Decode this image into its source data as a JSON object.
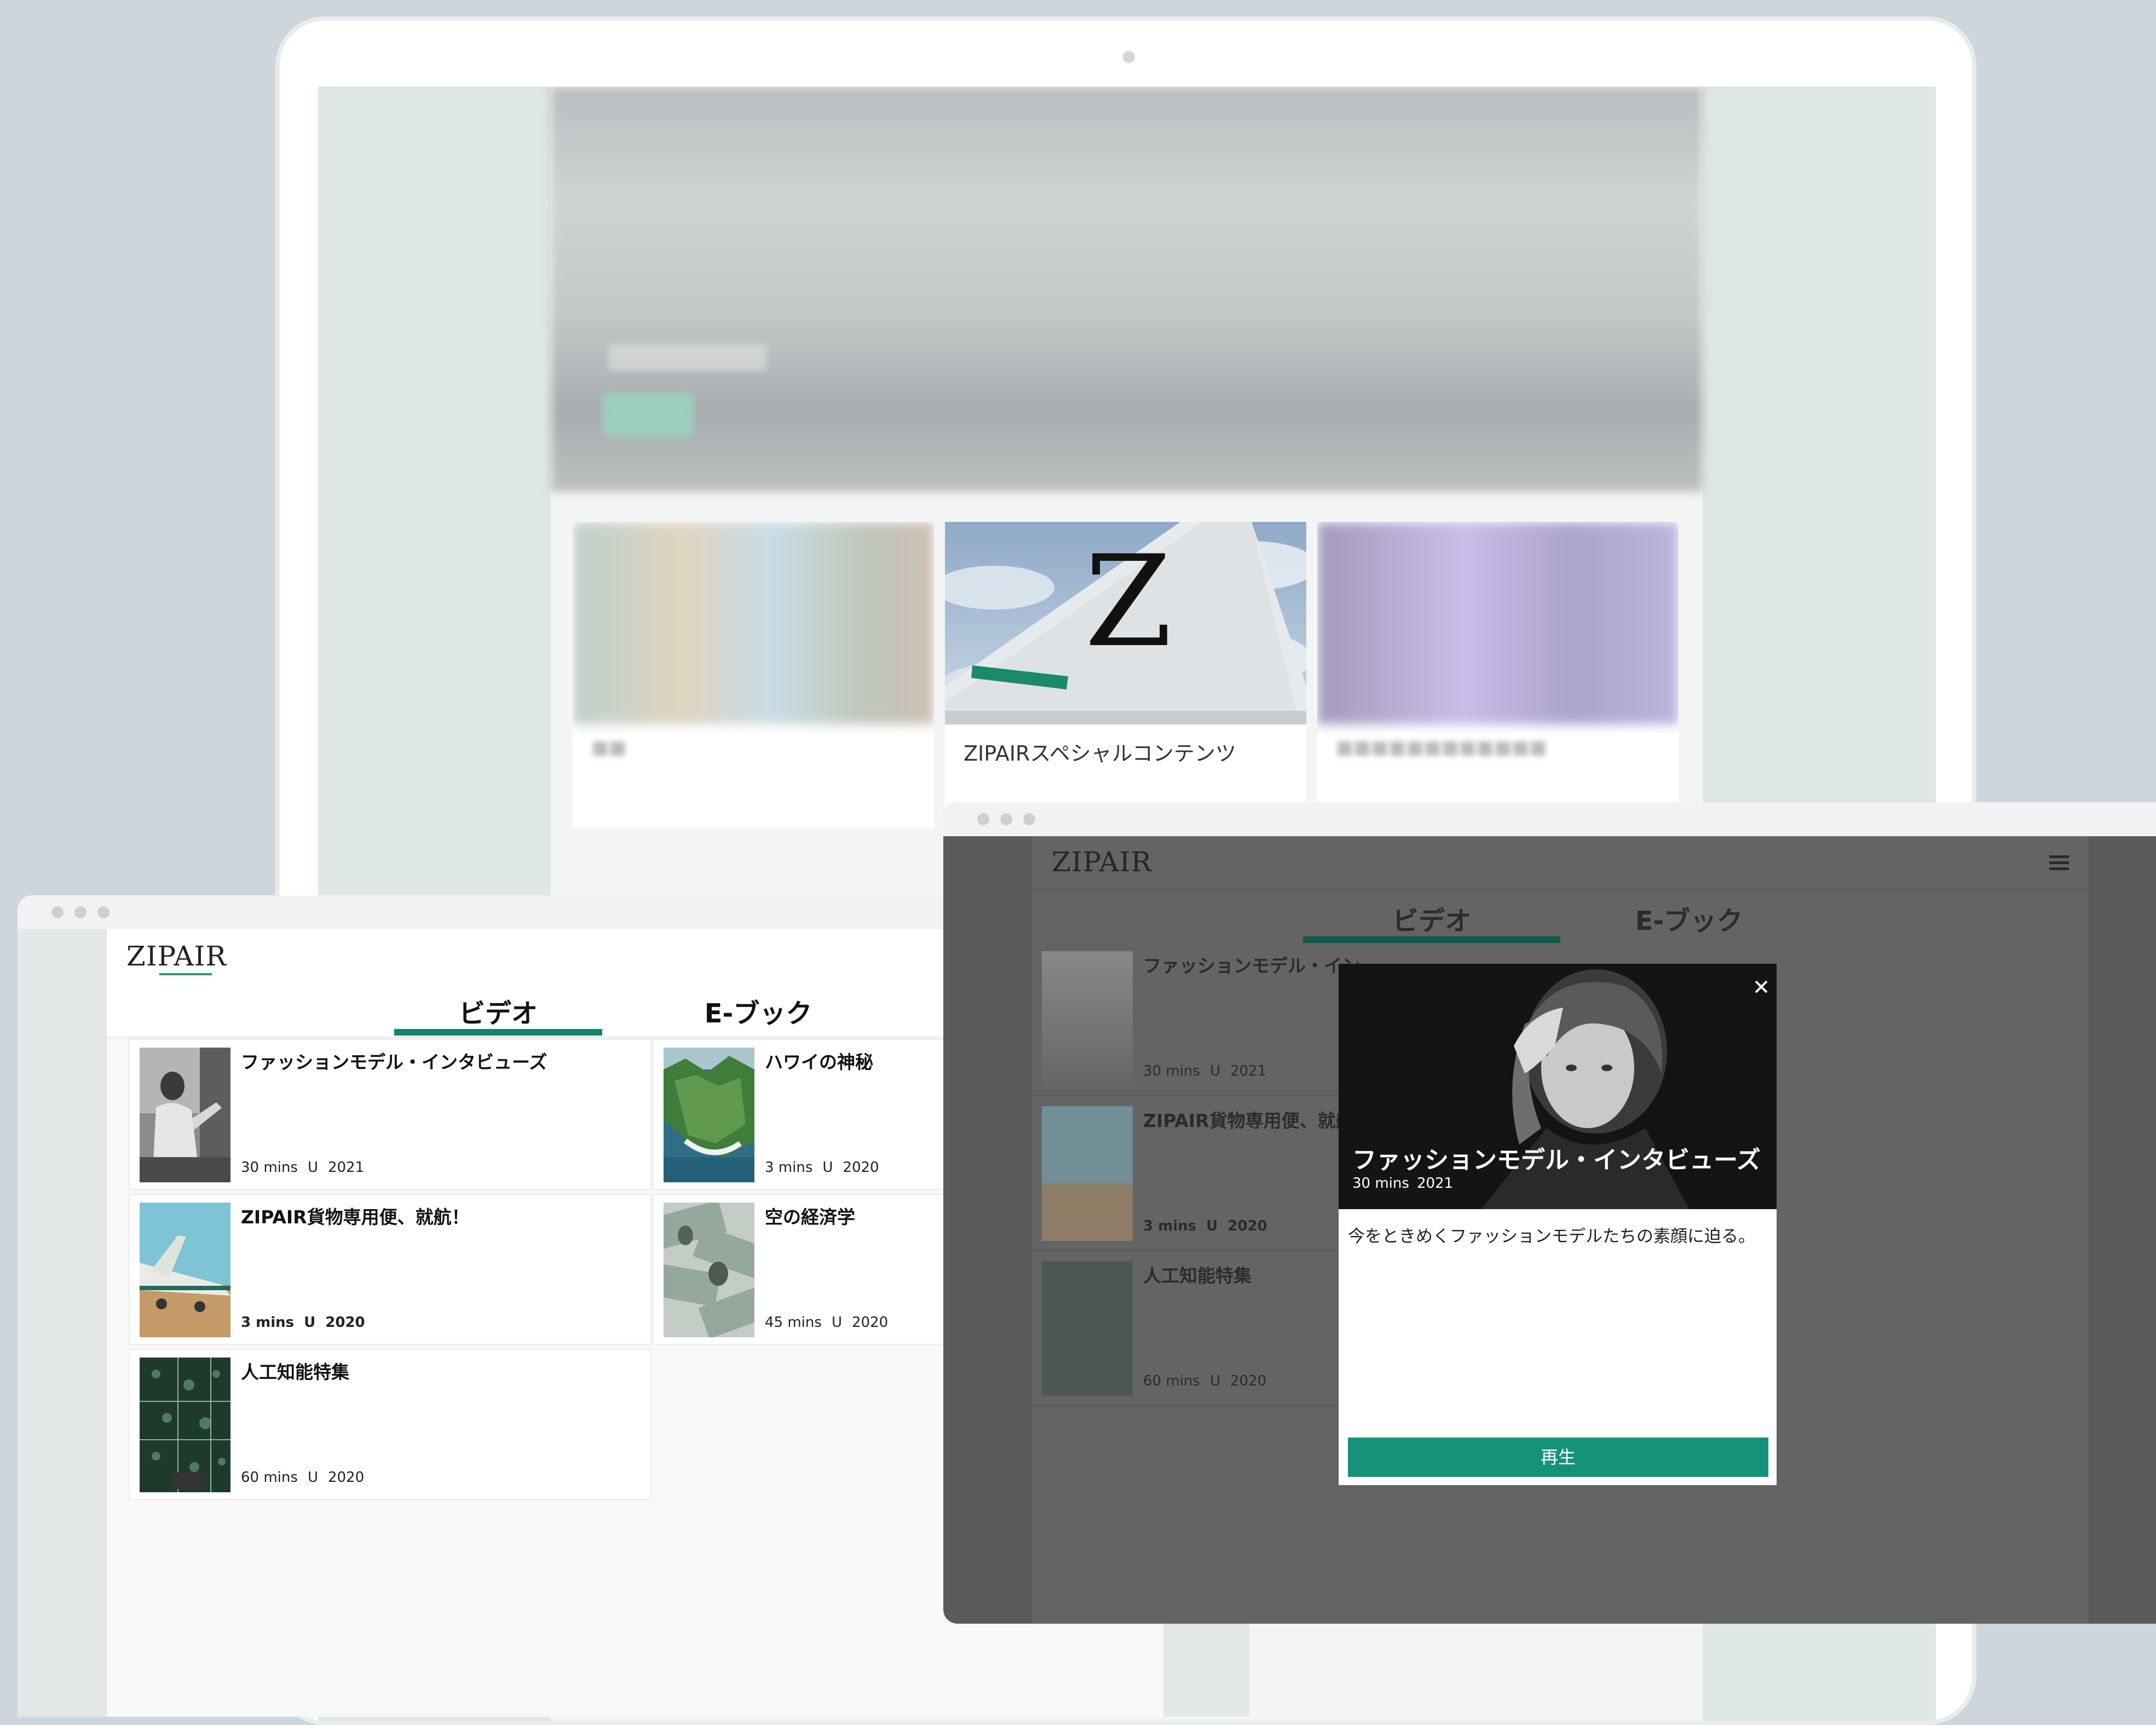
{
  "brand": {
    "logo": "ZIPAIR",
    "accent_color": "#15937a"
  },
  "laptop": {
    "featured_card_caption": "ZIPAIRスペシャルコンテンツ"
  },
  "tabs": {
    "video": "ビデオ",
    "ebook": "E-ブック"
  },
  "videos": [
    {
      "title": "ファッションモデル・インタビューズ",
      "duration": "30 mins",
      "rating": "U",
      "year": "2021"
    },
    {
      "title": "ハワイの神秘",
      "duration": "3 mins",
      "rating": "U",
      "year": "2020"
    },
    {
      "title": "ZIPAIR貨物専用便、就航！",
      "duration": "3 mins",
      "rating": "U",
      "year": "2020"
    },
    {
      "title": "空の経済学",
      "duration": "45 mins",
      "rating": "U",
      "year": "2020"
    },
    {
      "title": "人工知能特集",
      "duration": "60 mins",
      "rating": "U",
      "year": "2020"
    }
  ],
  "right_window": {
    "rows": [
      {
        "title": "ファッションモデル・イン",
        "duration": "30 mins",
        "rating": "U",
        "year": "2021"
      },
      {
        "title": "ZIPAIR貨物専用便、就航",
        "duration": "3 mins",
        "rating": "U",
        "year": "2020"
      },
      {
        "title": "人工知能特集",
        "duration": "60 mins",
        "rating": "U",
        "year": "2020"
      }
    ]
  },
  "modal": {
    "title": "ファッションモデル・インタビューズ",
    "duration": "30 mins",
    "year": "2021",
    "description": "今をときめくファッションモデルたちの素顔に迫る。",
    "play_label": "再生",
    "close_icon": "close-icon"
  }
}
